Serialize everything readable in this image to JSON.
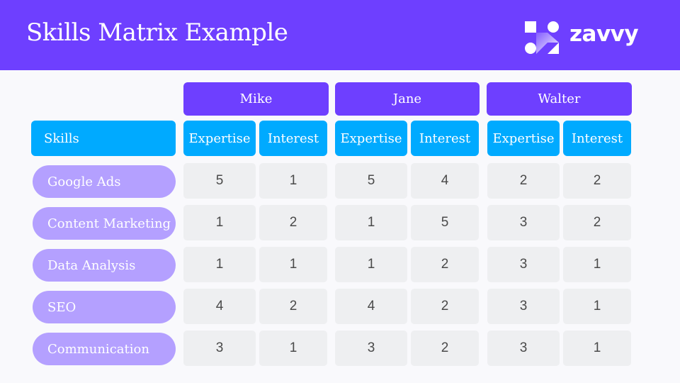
{
  "header": {
    "title": "Skills Matrix Example",
    "logo_text": "zavvy",
    "logo_icon": "zavvy-logo-icon"
  },
  "colors": {
    "header_bg": "#6E3FFF",
    "person_header": "#6E3FFF",
    "sub_header": "#00AAFF",
    "skill_pill": "#B4A0FF",
    "cell_bg": "#EEEFF1",
    "page_bg": "#F9F9FC"
  },
  "table": {
    "skills_label": "Skills",
    "people": [
      {
        "name": "Mike",
        "columns": [
          "Expertise",
          "Interest"
        ]
      },
      {
        "name": "Jane",
        "columns": [
          "Expertise",
          "Interest"
        ]
      },
      {
        "name": "Walter",
        "columns": [
          "Expertise",
          "Interest"
        ]
      }
    ],
    "rows": [
      {
        "skill": "Google Ads",
        "values": [
          "5",
          "1",
          "5",
          "4",
          "2",
          "2"
        ]
      },
      {
        "skill": "Content Marketing",
        "values": [
          "1",
          "2",
          "1",
          "5",
          "3",
          "2"
        ]
      },
      {
        "skill": "Data Analysis",
        "values": [
          "1",
          "1",
          "1",
          "2",
          "3",
          "1"
        ]
      },
      {
        "skill": "SEO",
        "values": [
          "4",
          "2",
          "4",
          "2",
          "3",
          "1"
        ]
      },
      {
        "skill": "Communication",
        "values": [
          "3",
          "1",
          "3",
          "2",
          "3",
          "1"
        ]
      }
    ]
  }
}
